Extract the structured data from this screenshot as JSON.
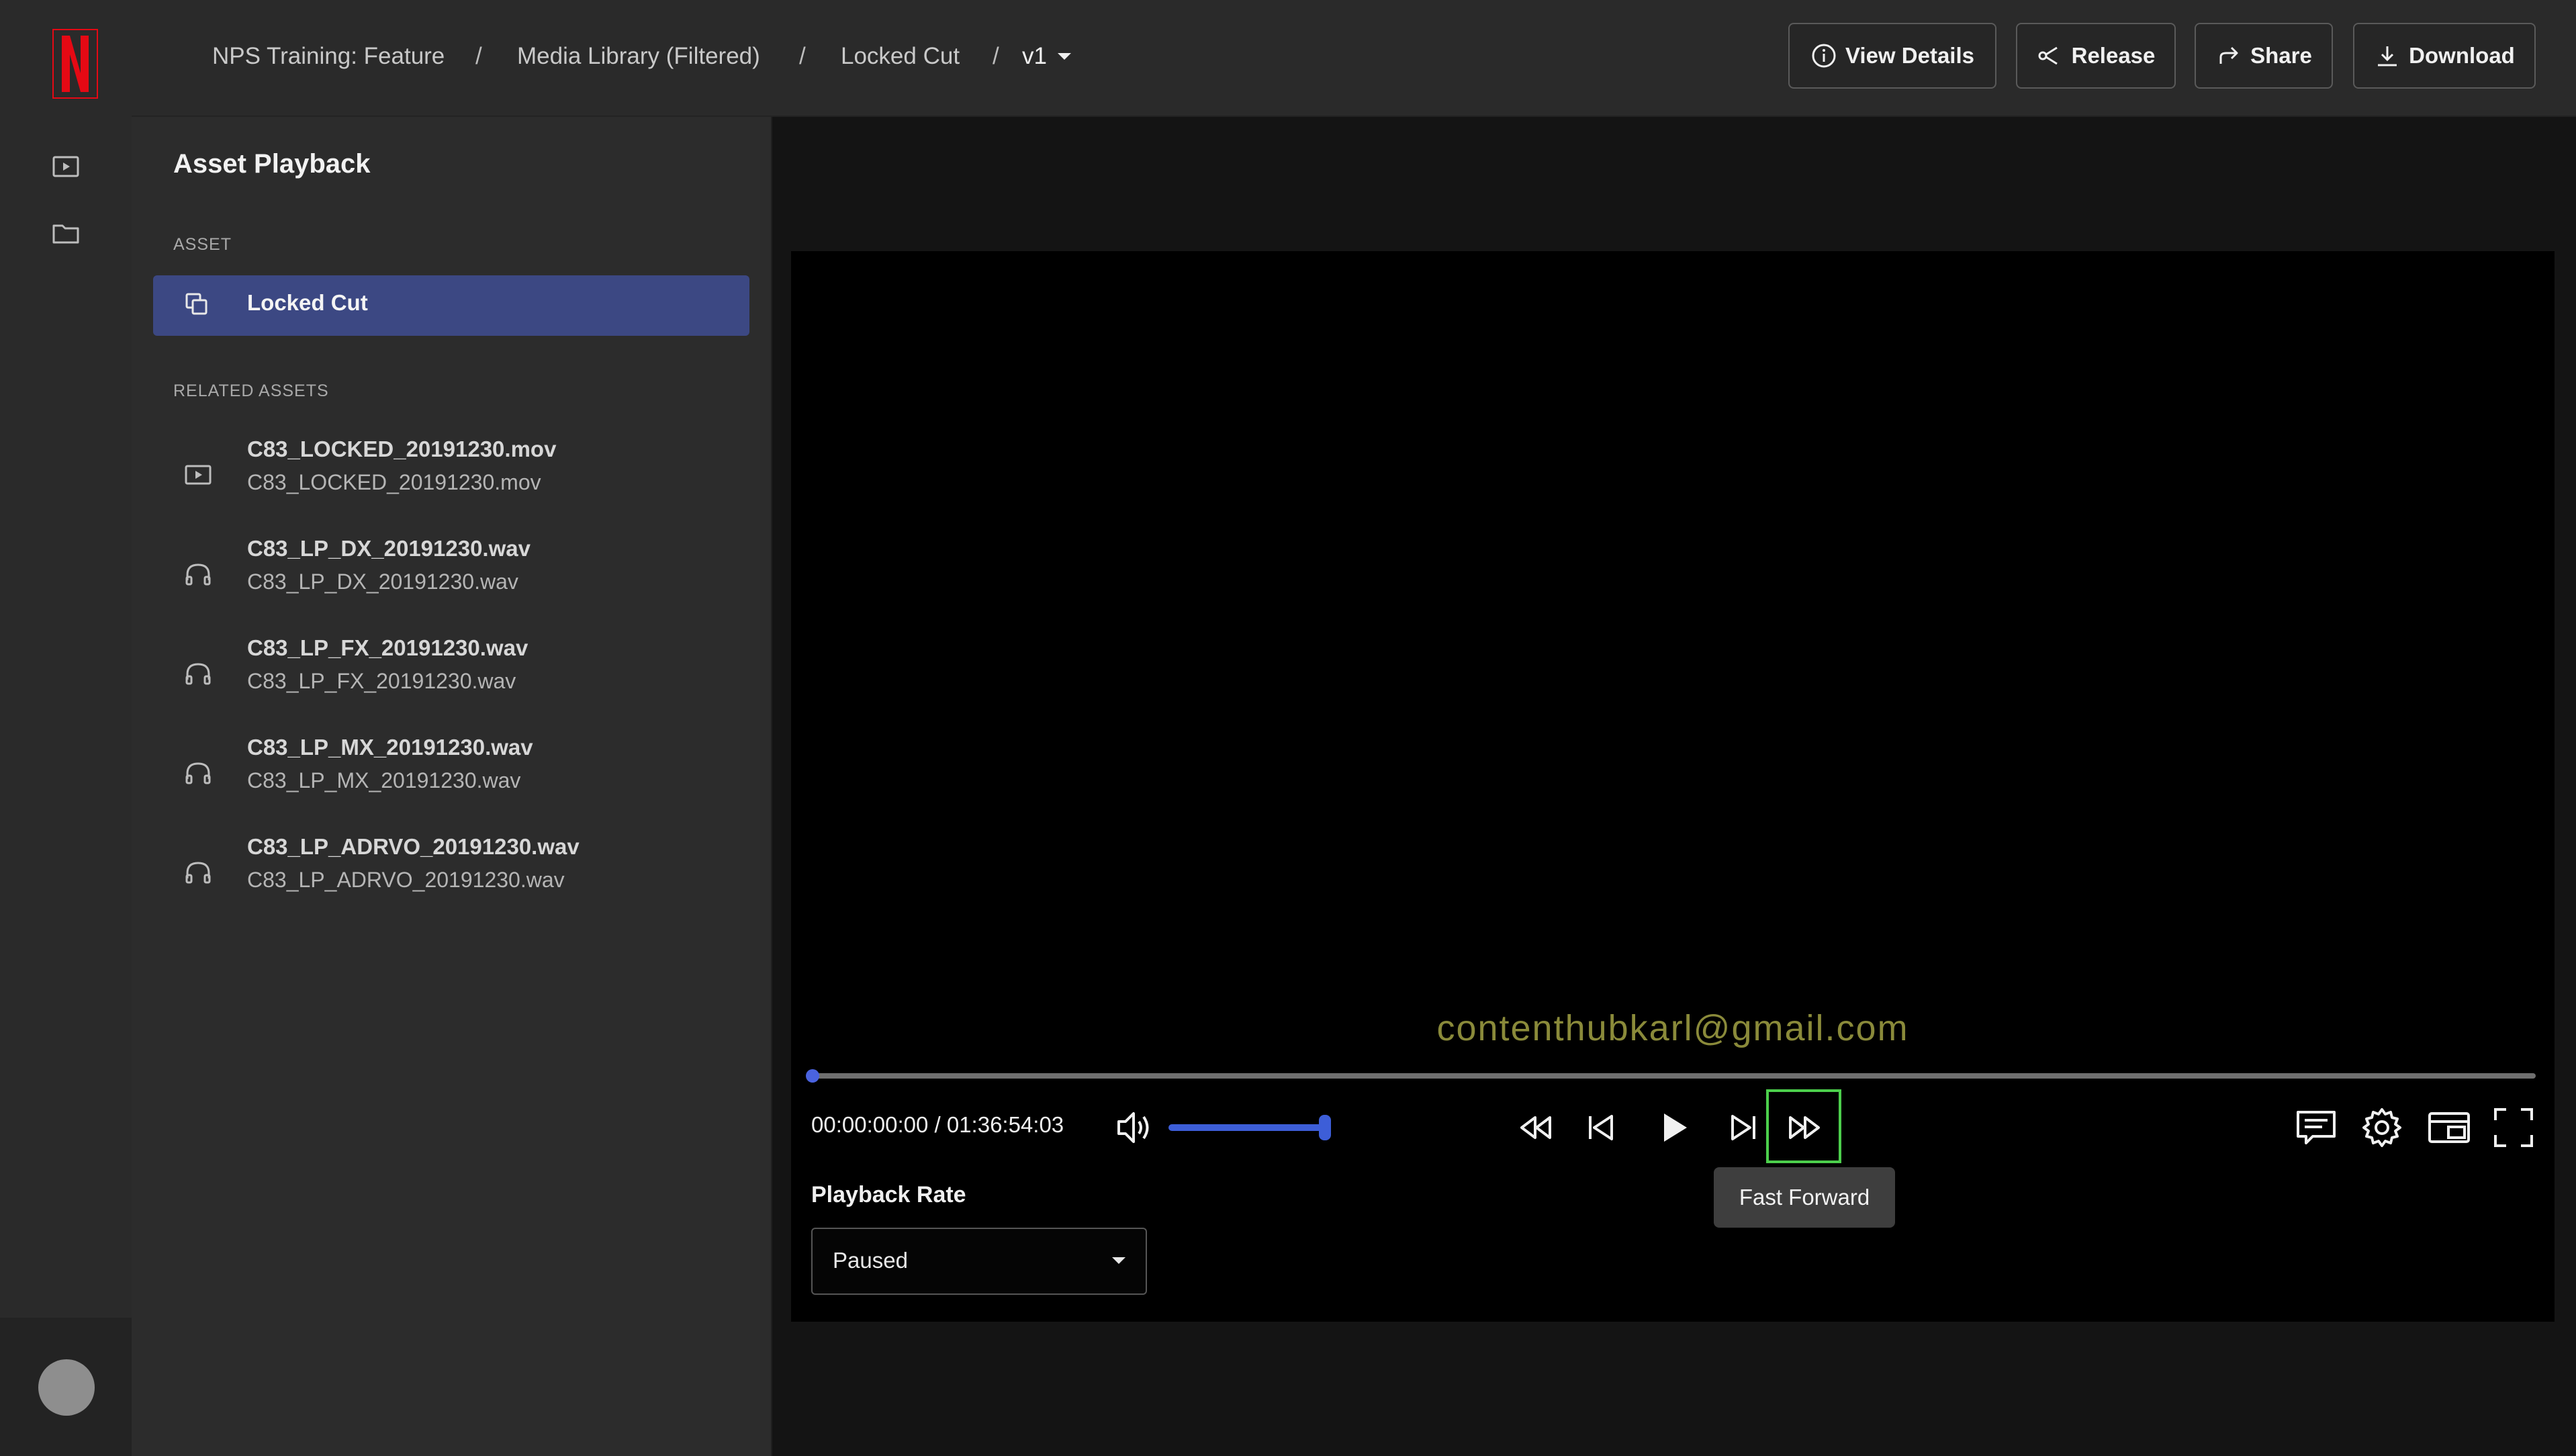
{
  "breadcrumb": {
    "items": [
      "NPS Training: Feature",
      "Media Library (Filtered)",
      "Locked Cut"
    ],
    "separator": "/",
    "version": "v1"
  },
  "header_actions": {
    "view_details": "View Details",
    "release": "Release",
    "share": "Share",
    "download": "Download"
  },
  "rail": {
    "logo_letter": "N",
    "brand_color": "#e50914",
    "nav_icons": [
      "play-box-icon",
      "folder-icon"
    ]
  },
  "panel": {
    "title": "Asset Playback",
    "asset_section": "ASSET",
    "active_asset": "Locked Cut",
    "related_section": "RELATED ASSETS",
    "related": [
      {
        "name": "C83_LOCKED_20191230.mov",
        "file": "C83_LOCKED_20191230.mov",
        "icon": "video-icon"
      },
      {
        "name": "C83_LP_DX_20191230.wav",
        "file": "C83_LP_DX_20191230.wav",
        "icon": "headphones-icon"
      },
      {
        "name": "C83_LP_FX_20191230.wav",
        "file": "C83_LP_FX_20191230.wav",
        "icon": "headphones-icon"
      },
      {
        "name": "C83_LP_MX_20191230.wav",
        "file": "C83_LP_MX_20191230.wav",
        "icon": "headphones-icon"
      },
      {
        "name": "C83_LP_ADRVO_20191230.wav",
        "file": "C83_LP_ADRVO_20191230.wav",
        "icon": "headphones-icon"
      }
    ]
  },
  "player": {
    "watermark": "contenthubkarl@gmail.com",
    "timecode": "00:00:00:00 / 01:36:54:03",
    "progress_fraction": 0.0,
    "volume_fraction": 1.0,
    "tooltip": "Fast Forward",
    "playback_rate_label": "Playback Rate",
    "playback_rate_value": "Paused",
    "accent_color": "#3d5ed8",
    "highlight_color": "#4ccf4c"
  }
}
